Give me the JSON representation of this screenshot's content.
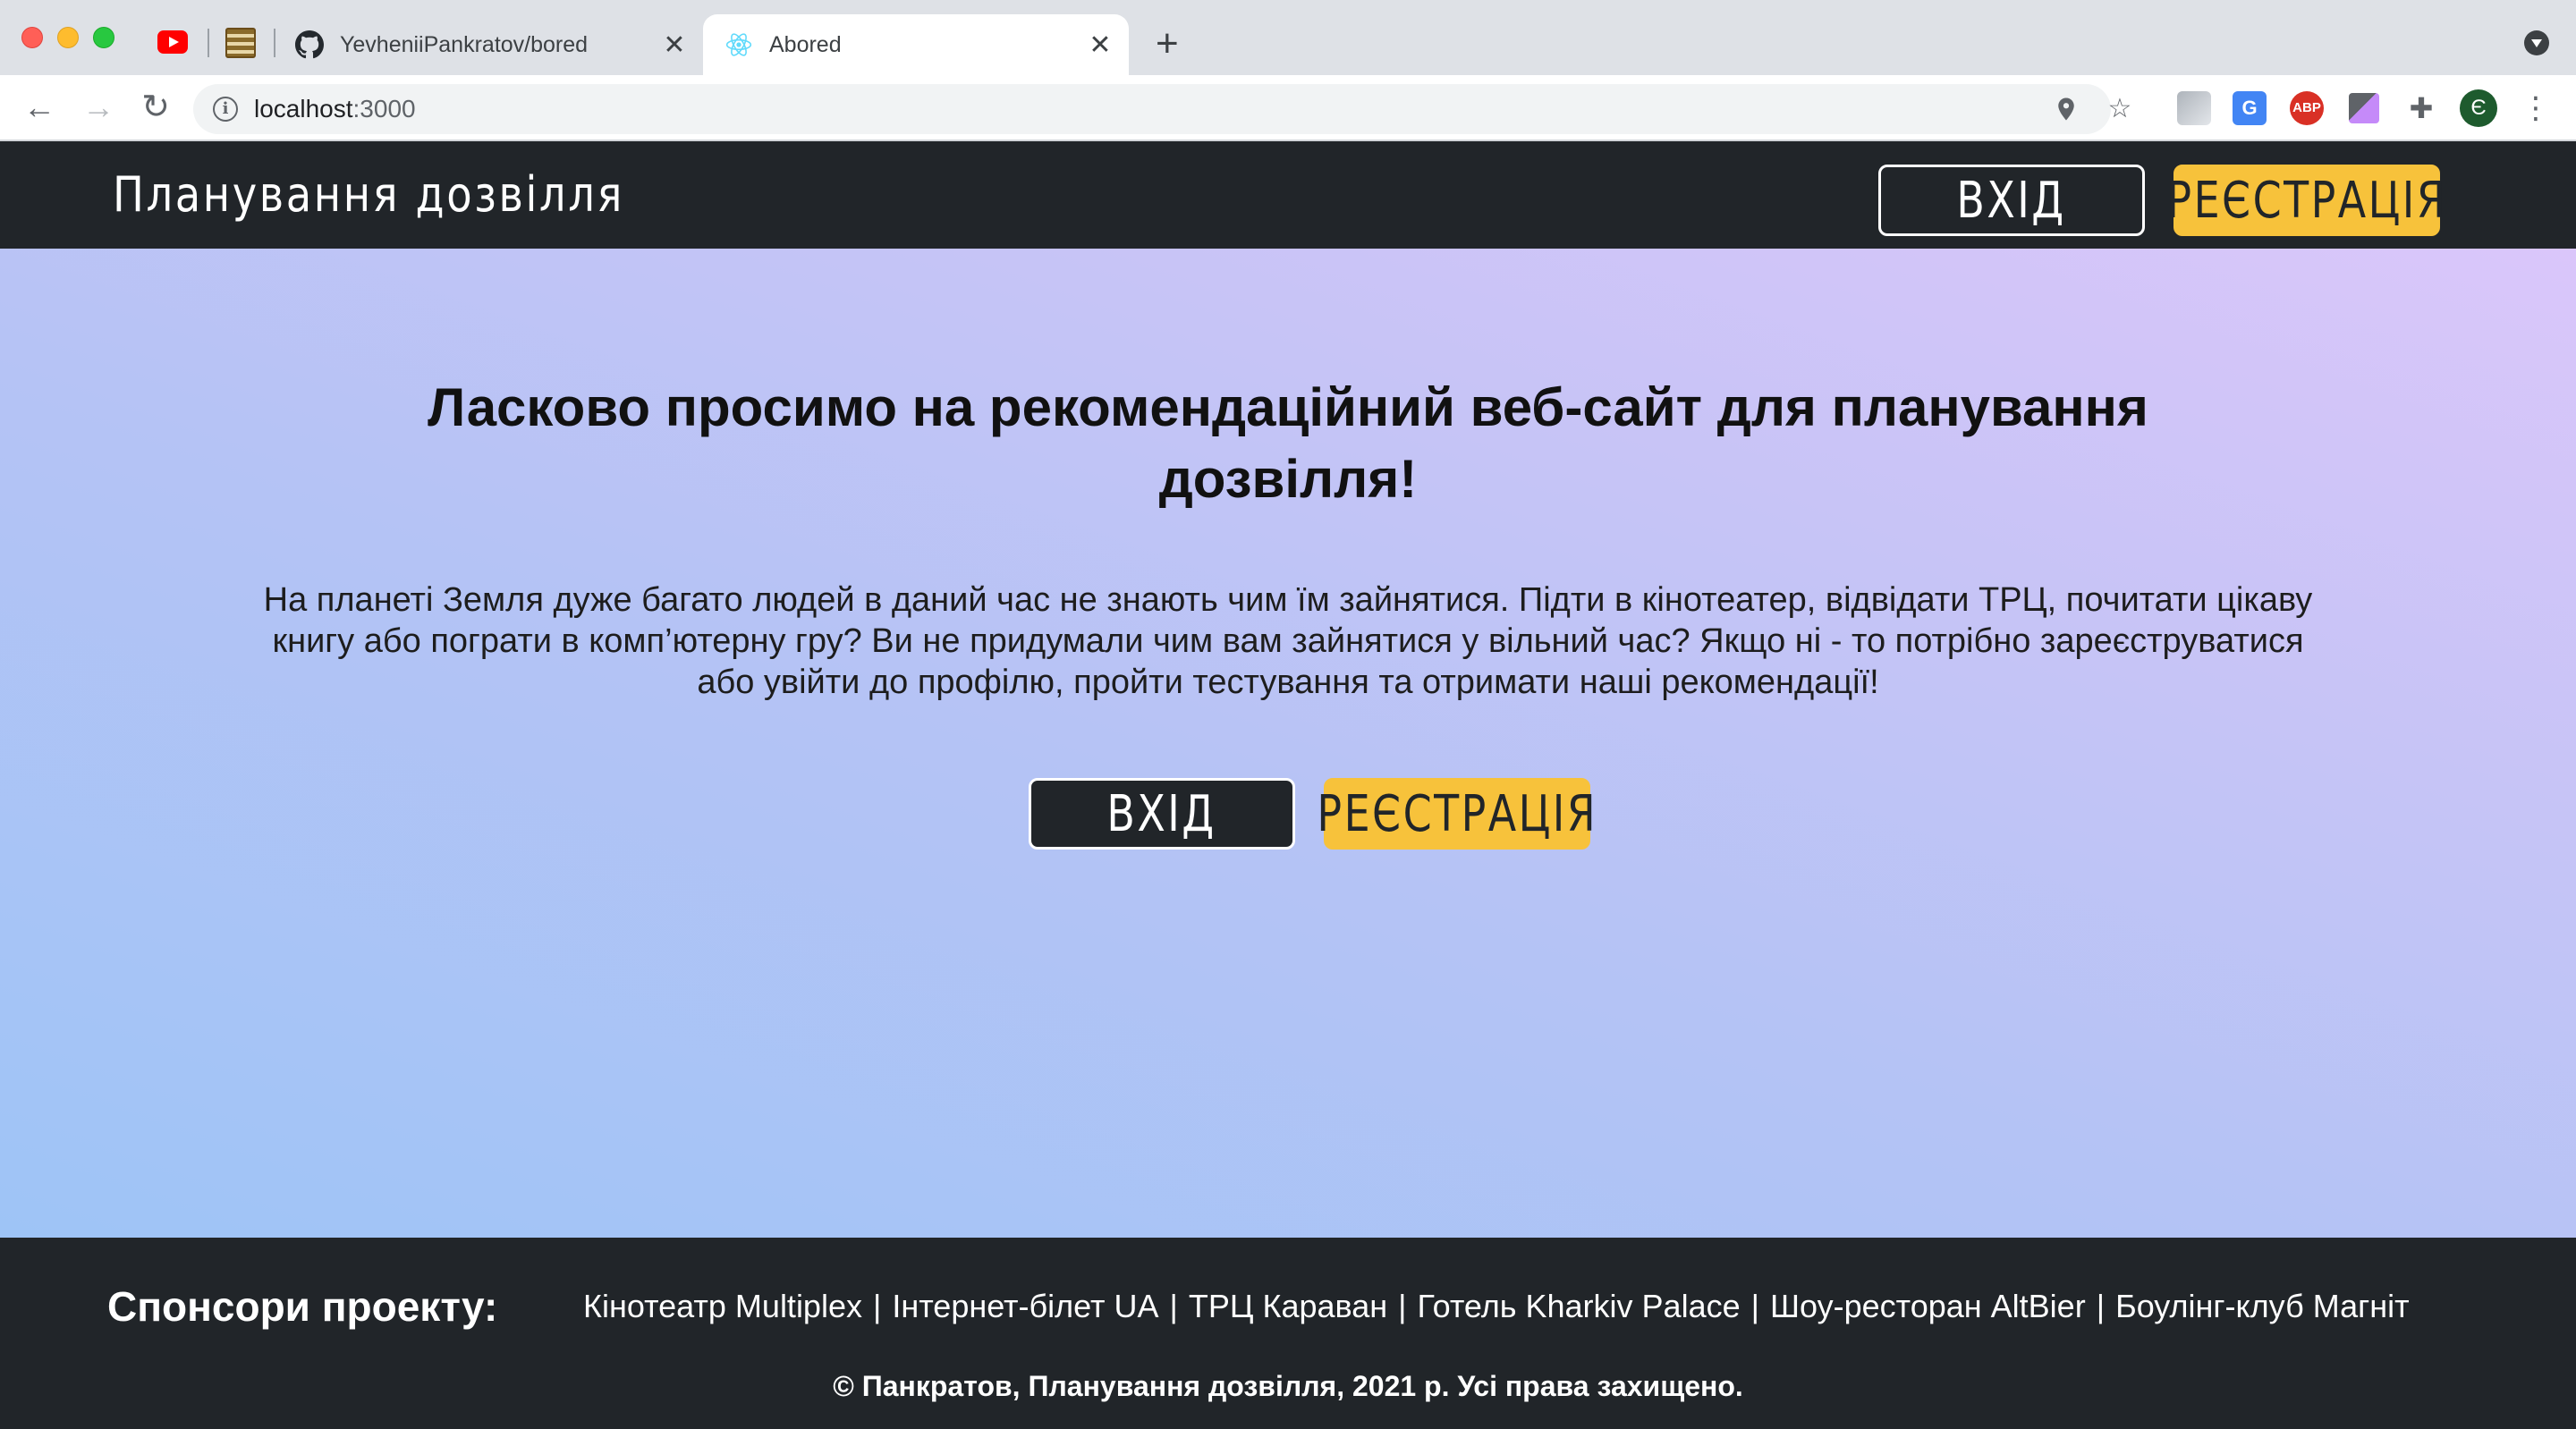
{
  "browser": {
    "tabs": [
      {
        "title": "YevheniiPankratov/bored",
        "icon": "github-icon"
      },
      {
        "title": "Abored",
        "icon": "react-icon",
        "active": true
      }
    ],
    "address": {
      "host": "localhost",
      "port": ":3000"
    },
    "profile_initial": "Є",
    "new_tab": "+",
    "close_glyph": "✕"
  },
  "header": {
    "brand": "Планування дозвілля",
    "login_label": "ВХІД",
    "register_label": "РЕЄСТРАЦІЯ"
  },
  "hero": {
    "title": "Ласково просимо на рекомендаційний веб-сайт для планування дозвілля!",
    "description": "На планеті Земля дуже багато людей в даний час не знають чим їм зайнятися. Підти в кінотеатер, відвідати ТРЦ, почитати цікаву книгу або пограти в комп’ютерну гру? Ви не придумали чим вам зайнятися у вільний час? Якщо ні - то потрібно зареєструватися або увійти до профілю, пройти тестування та отримати наші рекомендації!",
    "login_label": "ВХІД",
    "register_label": "РЕЄСТРАЦІЯ"
  },
  "footer": {
    "sponsors_title": "Спонсори проекту:",
    "sponsors": [
      "Кінотеатр Multiplex",
      "Інтернет-білет UA",
      "ТРЦ Караван",
      "Готель Kharkiv Palace",
      "Шоу-ресторан AltBier",
      "Боулінг-клуб Магніт"
    ],
    "divider": "|",
    "copyright": "© Панкратов, Планування дозвілля, 2021 р. Усі права захищено."
  },
  "colors": {
    "dark": "#212529",
    "accent": "#f7c23b",
    "gradient_start": "#9ec4f6",
    "gradient_end": "#dac6fa"
  }
}
